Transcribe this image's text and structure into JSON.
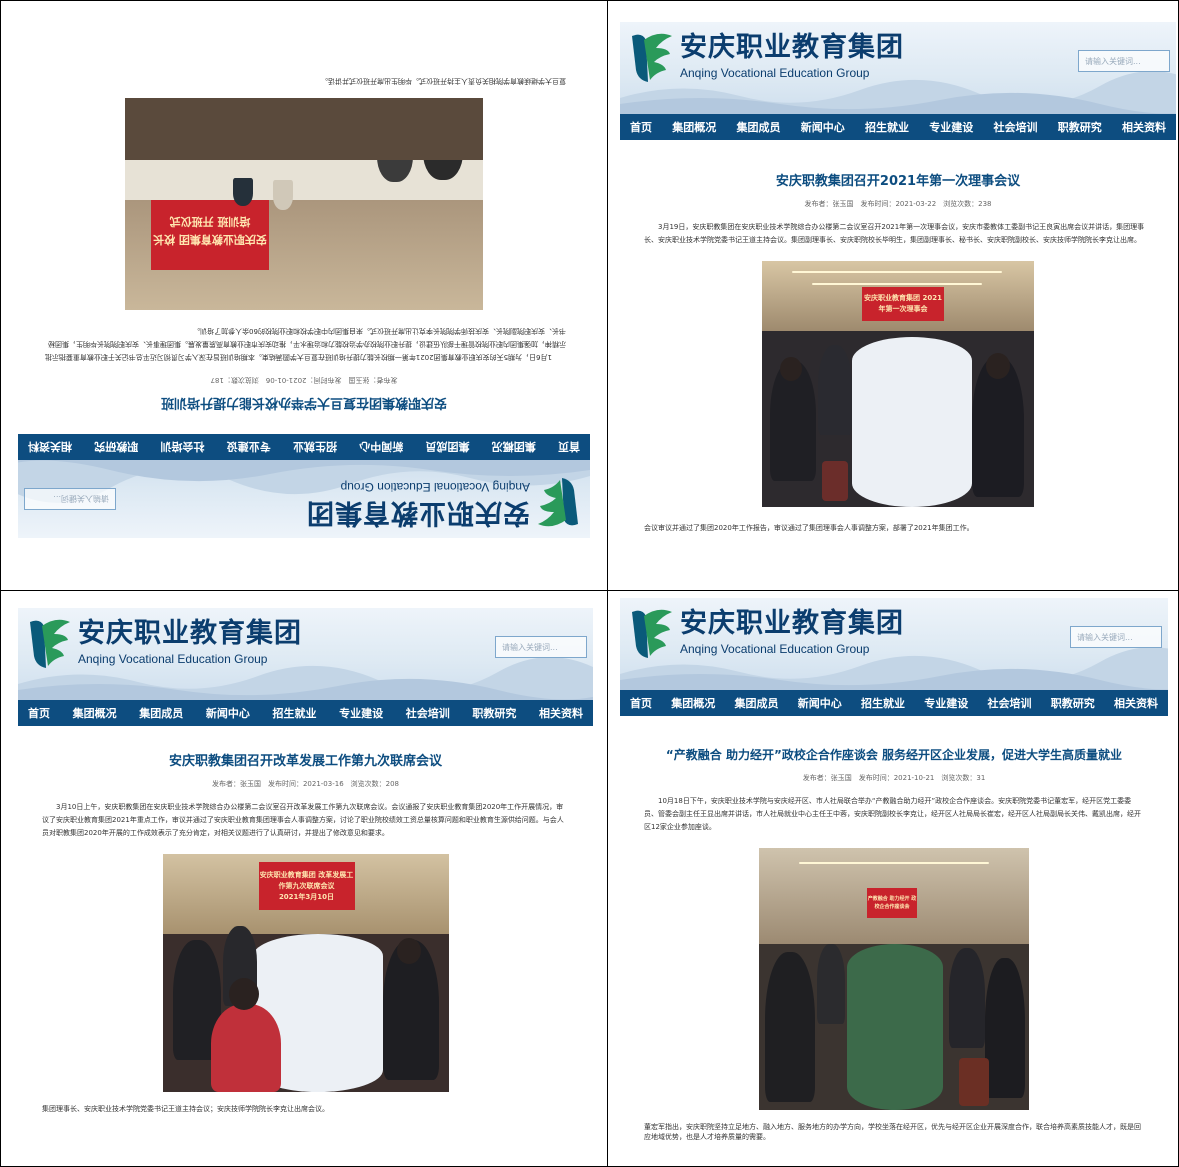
{
  "site": {
    "name_cn": "安庆职业教育集团",
    "name_en": "Anqing Vocational Education Group",
    "search_placeholder": "请输入关键词...",
    "nav": [
      "首页",
      "集团概况",
      "集团成员",
      "新闻中心",
      "招生就业",
      "专业建设",
      "社会培训",
      "职教研究",
      "相关资料"
    ],
    "colors": {
      "nav_bg": "#0d4d80",
      "title": "#0d4d80",
      "banner": "#c8232c"
    }
  },
  "panels": [
    {
      "title": "安庆职教集团在复旦大学举办校长能力提升培训班",
      "meta": "发布者：张玉国　发布时间：2021-01-06　浏览次数：187",
      "body": "1月6日，为期5天的安庆职业教育集团2021年第一期校长能力提升培训班在复旦大学圆满结束。本期培训班旨在深入学习贯彻习近平总书记关于职业教育重要指示批示精神，加强集团内职业院校管理干部队伍建设，提升职业院校办学治校能力和治理水平，推动安庆市职业教育高质量发展。集团理事长、安庆职院院长毕明生，集团秘书长、安庆职院副院长、安庆技师学院院长李克让出席开班仪式。来自集团内中职学校和职业院校的60余人参加了培训。",
      "banner": "安庆职业教育集团 校长培训班 开班仪式",
      "caption": "复旦大学继续教育学院相关负责人主持开班仪式。毕明生出席开班仪式并讲话。",
      "mirrored": true
    },
    {
      "title": "安庆职教集团召开2021年第一次理事会议",
      "meta": "发布者：张玉国　发布时间：2021-03-22　浏览次数：238",
      "body": "3月19日，安庆职教集团在安庆职业技术学院综合办公楼第二会议室召开2021年第一次理事会议，安庆市委教体工委副书记王良寅出席会议并讲话，集团理事长、安庆职业技术学院党委书记王道主持会议。集团副理事长、安庆职院校长毕明生，集团副理事长、秘书长、安庆职院副校长、安庆技师学院院长李克让出席。",
      "banner": "安庆职业教育集团 2021年第一次理事会",
      "caption": "会议审议并通过了集团2020年工作报告，审议通过了集团理事会人事调整方案，部署了2021年集团工作。",
      "mirrored": false
    },
    {
      "title": "安庆职教集团召开改革发展工作第九次联席会议",
      "meta": "发布者：张玉国　发布时间：2021-03-16　浏览次数：208",
      "body": "3月10日上午，安庆职教集团在安庆职业技术学院综合办公楼第二会议室召开改革发展工作第九次联席会议。会议通报了安庆职业教育集团2020年工作开展情况，审议了安庆职业教育集团2021年重点工作，审议并通过了安庆职业教育集团理事会人事调整方案，讨论了职业院校绩效工资总量核算问题和职业教育生源供给问题。与会人员对职教集团2020年开展的工作成效表示了充分肯定，对相关议题进行了认真研讨，并提出了修改意见和要求。",
      "banner": "安庆职业教育集团 改革发展工作第九次联席会议",
      "banner_date": "2021年3月10日",
      "caption": "集团理事长、安庆职业技术学院党委书记王道主持会议；安庆技师学院院长李克让出席会议。",
      "mirrored": false
    },
    {
      "title": "“产教融合 助力经开”政校企合作座谈会 服务经开区企业发展，促进大学生高质量就业",
      "meta": "发布者：张玉国　发布时间：2021-10-21　浏览次数：31",
      "body": "10月18日下午，安庆职业技术学院与安庆经开区、市人社局联合举办“产教融合助力经开”政校企合作座谈会。安庆职院党委书记董宏军，经开区党工委委员、管委会副主任王显出席并讲话，市人社局就业中心主任王中蓉，安庆职院副校长李克让，经开区人社局局长崔宏，经开区人社局副局长关伟、戴凯出席，经开区12家企业参加座谈。",
      "banner": "产教融合 助力经开 政校企合作座谈会",
      "caption": "董宏军指出，安庆职院坚持立足地方、融入地方、服务地方的办学方向，学校坐落在经开区，优先与经开区企业开展深度合作，联合培养高素质技能人才，既是回应地域优势，也是人才培养质量的需要。",
      "mirrored": false
    }
  ]
}
